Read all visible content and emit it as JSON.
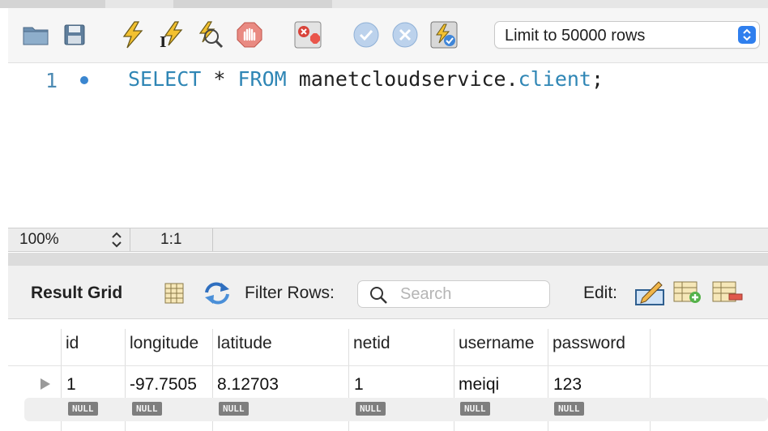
{
  "toolbar": {
    "icons": [
      "open-folder-icon",
      "save-icon",
      "execute-lightning-icon",
      "execute-current-icon",
      "explain-icon",
      "stop-icon",
      "toggle-error-stop-icon",
      "commit-icon",
      "rollback-icon",
      "autocommit-icon"
    ],
    "limit_select": "Limit to 50000 rows"
  },
  "editor": {
    "line_number": "1",
    "code": {
      "kw1": "SELECT",
      "star": " * ",
      "kw2": "FROM",
      "schema": " manetcloudservice.",
      "table": "client",
      "end": ";"
    }
  },
  "statusbar": {
    "zoom": "100%",
    "cursor": "1:1"
  },
  "results": {
    "title": "Result Grid",
    "filter_label": "Filter Rows:",
    "search_placeholder": "Search",
    "edit_label": "Edit:",
    "columns": [
      "id",
      "longitude",
      "latitude",
      "netid",
      "username",
      "password"
    ],
    "rows": [
      [
        "1",
        "-97.7505",
        "8.12703",
        "1",
        "meiqi",
        "123"
      ]
    ],
    "null_label": "NULL"
  },
  "colors": {
    "keyword": "#2f86b5",
    "accent": "#2f7fee"
  }
}
